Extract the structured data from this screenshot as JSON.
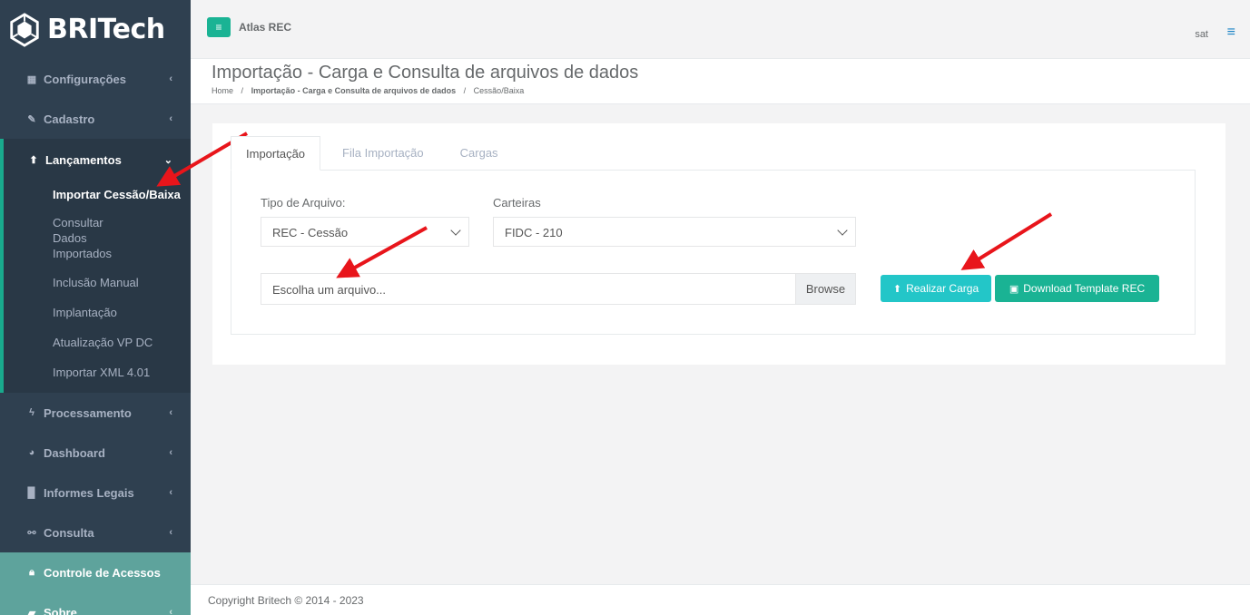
{
  "brand": {
    "name": "BRITech"
  },
  "topbar": {
    "app_title": "Atlas REC",
    "user": "sat"
  },
  "sidebar": {
    "items": [
      {
        "label": "Configurações",
        "icon": "th-large-icon"
      },
      {
        "label": "Cadastro",
        "icon": "edit-icon"
      },
      {
        "label": "Lançamentos",
        "icon": "upload-icon"
      },
      {
        "label": "Processamento",
        "icon": "bolt-icon"
      },
      {
        "label": "Dashboard",
        "icon": "pie-chart-icon"
      },
      {
        "label": "Informes Legais",
        "icon": "building-icon"
      },
      {
        "label": "Consulta",
        "icon": "binoculars-icon"
      },
      {
        "label": "Controle de Acessos",
        "icon": "lock-icon"
      },
      {
        "label": "Sobre",
        "icon": "book-icon"
      }
    ],
    "subitems": [
      {
        "label": "Importar Cessão/Baixa"
      },
      {
        "label": "Consultar Dados Importados"
      },
      {
        "label": "Inclusão Manual"
      },
      {
        "label": "Implantação"
      },
      {
        "label": "Atualização VP DC"
      },
      {
        "label": "Importar XML 4.01"
      }
    ]
  },
  "heading": {
    "title": "Importação - Carga e Consulta de arquivos de dados",
    "breadcrumb": [
      "Home",
      "Importação - Carga e Consulta de arquivos de dados",
      "Cessão/Baixa"
    ],
    "separator": "/"
  },
  "tabs": [
    "Importação",
    "Fila Importação",
    "Cargas"
  ],
  "form": {
    "tipo_label": "Tipo de Arquivo:",
    "tipo_value": "REC - Cessão",
    "carteiras_label": "Carteiras",
    "carteiras_value": "FIDC - 210",
    "file_placeholder": "Escolha um arquivo...",
    "browse_label": "Browse",
    "realizar_label": "Realizar Carga",
    "download_label": "Download Template REC"
  },
  "footer": {
    "copyright": "Copyright Britech © 2014 - 2023"
  },
  "colors": {
    "sidebar": "#2f4050",
    "accent": "#1ab394",
    "info": "#23c6c8",
    "annotation_arrow": "#e8151b"
  }
}
